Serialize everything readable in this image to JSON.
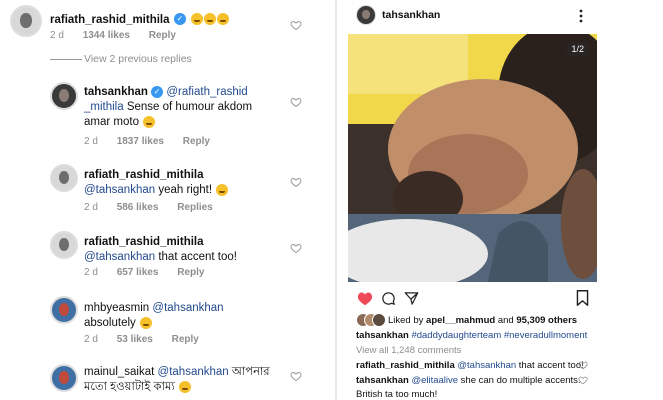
{
  "left": {
    "c1": {
      "user": "rafiath_rashid_mithila",
      "time": "2 d",
      "likes": "1344 likes",
      "reply": "Reply"
    },
    "view_replies": "View 2 previous replies",
    "c2": {
      "user": "tahsankhan",
      "mention": "@rafiath_rashid",
      "mention2": "_mithila",
      "text": " Sense of humour akdom",
      "text2": "amar moto",
      "time": "2 d",
      "likes": "1837 likes",
      "reply": "Reply"
    },
    "c3": {
      "user": "rafiath_rashid_mithila",
      "mention": "@tahsankhan",
      "text": " yeah right!",
      "time": "2 d",
      "likes": "586 likes",
      "reply": "Replies"
    },
    "c4": {
      "user": "rafiath_rashid_mithila",
      "mention": "@tahsankhan",
      "text": " that accent too!",
      "time": "2 d",
      "likes": "657 likes",
      "reply": "Reply"
    },
    "c5": {
      "user": "mhbyeasmin",
      "mention": "@tahsankhan",
      "text": "absolutely",
      "time": "2 d",
      "likes": "53 likes",
      "reply": "Reply"
    },
    "c6": {
      "user": "mainul_saikat",
      "mention": "@tahsankhan",
      "text": " আপনার",
      "text2": "মতো হওয়াটাই কাম্য"
    }
  },
  "right": {
    "username": "tahsankhan",
    "counter": "1/2",
    "liked_prefix": "Liked by ",
    "liked_user": "apel__mahmud",
    "liked_mid": " and ",
    "liked_count": "95,309 others",
    "caption_user": "tahsankhan",
    "caption_tags": "#daddydaughterteam #neveradullmoment",
    "view_all": "View all 1,248 comments",
    "c1_user": "rafiath_rashid_mithila",
    "c1_mention": "@tahsankhan",
    "c1_text": " that accent too!",
    "c2_user": "tahsankhan",
    "c2_mention": "@elitaalive",
    "c2_text": " she can do multiple accents.",
    "c2_text2": "British ta too much!"
  },
  "colors": {
    "accent": "#3897f0",
    "heart": "#ed4956",
    "mention": "#234a8e",
    "meta": "#8e8e8e"
  }
}
